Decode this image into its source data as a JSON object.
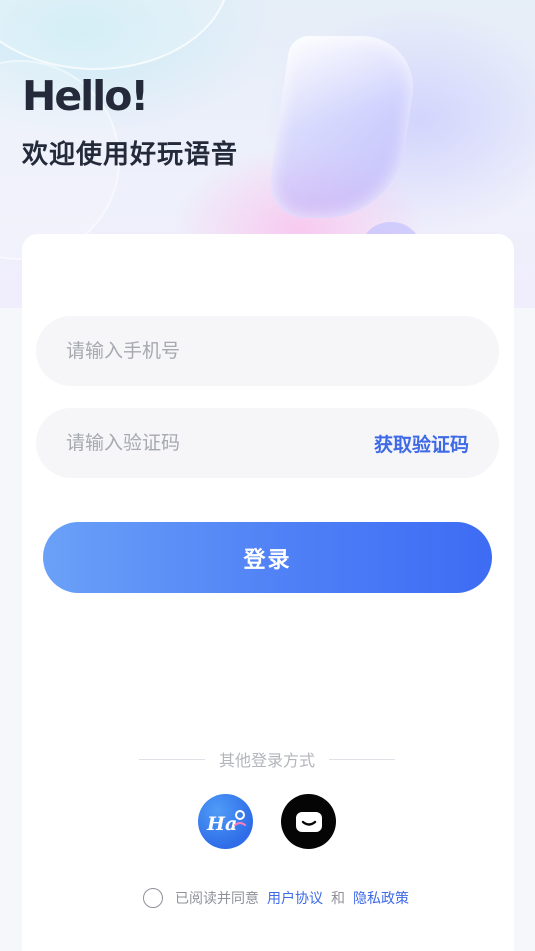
{
  "header": {
    "greeting": "Hello!",
    "welcome": "欢迎使用好玩语音"
  },
  "form": {
    "phone_placeholder": "请输入手机号",
    "code_placeholder": "请输入验证码",
    "get_code_label": "获取验证码",
    "login_label": "登录"
  },
  "other_login": {
    "title": "其他登录方式",
    "providers": [
      {
        "icon": "hao-app-icon",
        "badge_text": "Ha"
      },
      {
        "icon": "message-bubble-icon"
      }
    ]
  },
  "agreement": {
    "prefix": "已阅读并同意",
    "user_agreement": "用户协议",
    "and": "和",
    "privacy_policy": "隐私政策",
    "checked": false
  },
  "colors": {
    "accent": "#3e6ae6",
    "button_gradient_start": "#6aa1f7",
    "button_gradient_end": "#3d6cf4",
    "title": "#242a3a"
  }
}
